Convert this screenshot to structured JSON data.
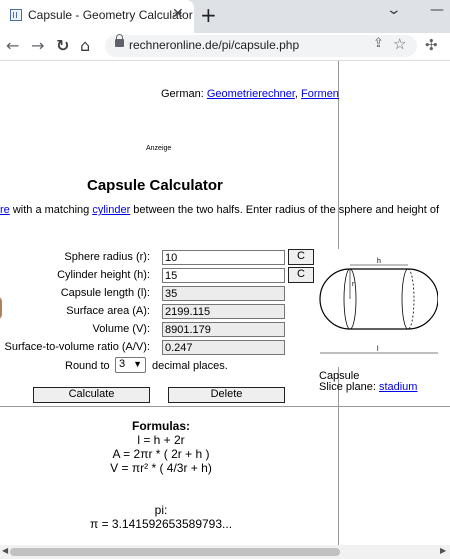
{
  "browser": {
    "tab_title": "Capsule - Geometry Calculator",
    "tab_close": "✕",
    "new_tab": "+",
    "url": "rechneronline.de/pi/capsule.php"
  },
  "page": {
    "german_prefix": "German: ",
    "german_link1": "Geometrierechner",
    "german_sep": ", ",
    "german_link2": "Formen",
    "ad_label": "Anzeige",
    "title": "Capsule Calculator",
    "intro_link1": "re",
    "intro_text1": " with a matching ",
    "intro_link2": "cylinder",
    "intro_text2": " between the two halfs. Enter radius of the sphere and height of"
  },
  "form": {
    "fields": [
      {
        "label": "Sphere radius (r):",
        "value": "10",
        "clear": "C"
      },
      {
        "label": "Cylinder height (h):",
        "value": "15",
        "clear": "C"
      },
      {
        "label": "Capsule length (l):",
        "value": "35"
      },
      {
        "label": "Surface area (A):",
        "value": "2199.115"
      },
      {
        "label": "Volume (V):",
        "value": "8901.179"
      },
      {
        "label": "Surface-to-volume ratio (A/V):",
        "value": "0.247"
      }
    ],
    "round_label": "Round to",
    "round_value": "3",
    "round_suffix": "decimal places.",
    "calculate": "Calculate",
    "delete": "Delete"
  },
  "figure": {
    "label_h": "h",
    "label_r": "r",
    "label_l": "l",
    "caption": "Capsule",
    "slice_prefix": "Slice plane: ",
    "slice_link": "stadium"
  },
  "formulas": {
    "heading": "Formulas:",
    "lines": [
      "l = h + 2r",
      "A = 2πr * ( 2r + h )",
      "V = πr² * ( 4/3r + h)"
    ],
    "pi_heading": "pi:",
    "pi_value": "π = 3.141592653589793..."
  }
}
